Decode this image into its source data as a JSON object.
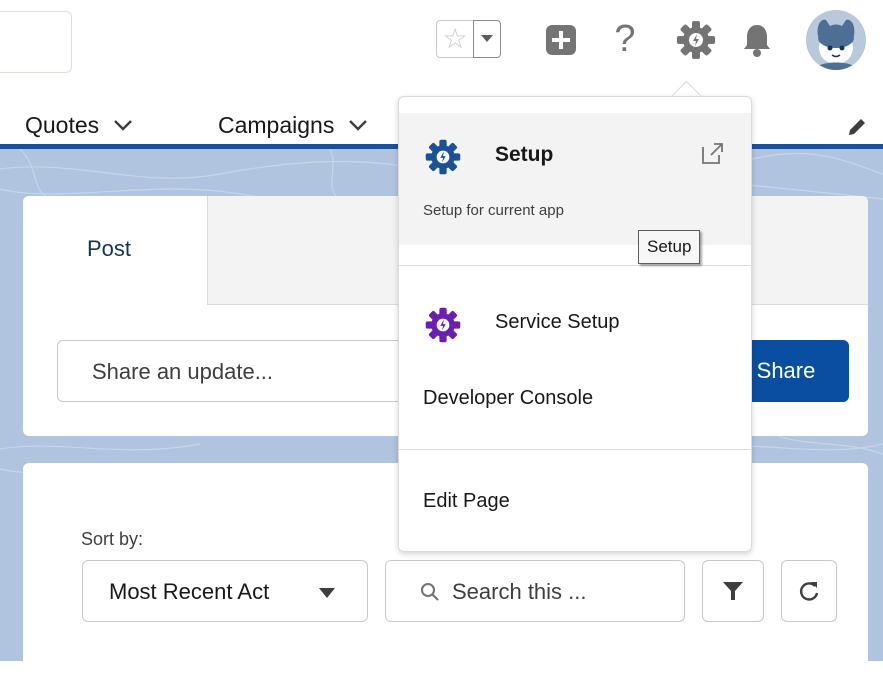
{
  "header": {
    "icons": {
      "favorite": "star-icon",
      "favorites_dropdown": "chevron-down-icon",
      "global_actions": "plus-icon",
      "help": "help-icon",
      "setup": "gear-icon",
      "notifications": "bell-icon",
      "avatar": "user-avatar"
    },
    "help_glyph": "?"
  },
  "nav": {
    "items": [
      {
        "label": "Quotes"
      },
      {
        "label": "Campaigns"
      }
    ]
  },
  "publisher": {
    "tab_label": "Post",
    "input_placeholder": "Share an update...",
    "share_label": "Share"
  },
  "feed": {
    "sort_label": "Sort by:",
    "sort_value": "Most Recent Act",
    "search_placeholder": "Search this ..."
  },
  "menu": {
    "setup": {
      "title": "Setup",
      "description": "Setup for current app",
      "tooltip": "Setup"
    },
    "service_setup": "Service Setup",
    "developer_console": "Developer Console",
    "edit_page": "Edit Page"
  },
  "colors": {
    "brand_blue": "#0a4ea1",
    "nav_border": "#1b5297",
    "setup_gear": "#1b5297",
    "service_gear": "#6b1fb1",
    "band_background": "#b0c4df"
  }
}
